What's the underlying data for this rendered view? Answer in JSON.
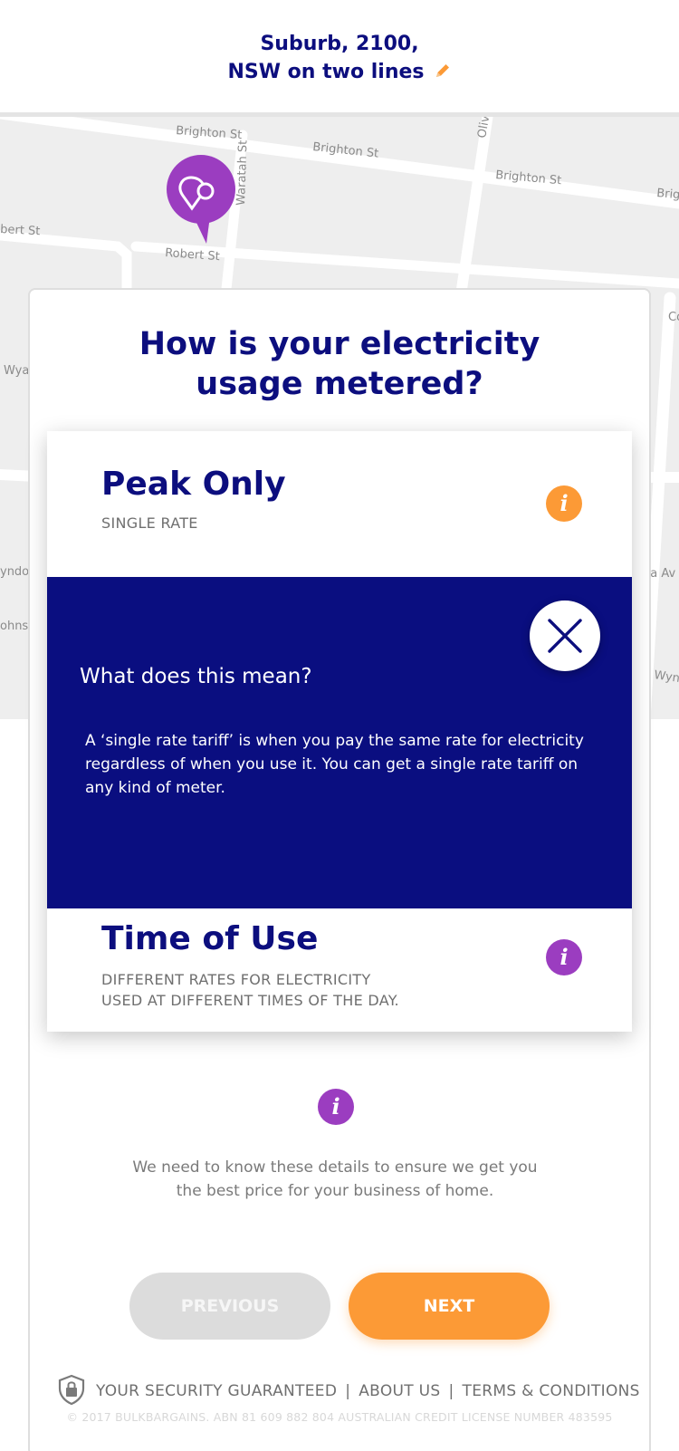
{
  "header": {
    "address_line1": "Suburb, 2100,",
    "address_line2": "NSW on two lines",
    "edit_icon": "pencil-icon",
    "edit_color": "#fc9a36"
  },
  "map": {
    "streets": [
      "Brighton St",
      "Brighton St",
      "Brighton St",
      "Brig",
      "Waratah St",
      "Robert St",
      "Olive",
      "bert St",
      "Wya",
      "Co",
      "yndo",
      "ohnsc",
      "na Av",
      "Wyn"
    ],
    "pin_icon": "location-pin-icon",
    "pin_color": "#9b3dc0"
  },
  "question": {
    "line1": "How is your electricity",
    "line2": "usage metered?"
  },
  "options": [
    {
      "title": "Peak Only",
      "subtitle": "SINGLE RATE",
      "info_icon": "info-icon",
      "info_color": "#fc9a36"
    },
    {
      "title": "Time of Use",
      "subtitle_line1": "DIFFERENT RATES FOR ELECTRICITY",
      "subtitle_line2": "USED AT DIFFERENT TIMES OF THE DAY.",
      "info_icon": "info-icon",
      "info_color": "#9b3dc0"
    }
  ],
  "popup": {
    "title": "What does this mean?",
    "body": "A ‘single rate tariff’ is when you pay the same rate for electricity regardless of when you use it. You can get a single rate tariff on any kind of meter.",
    "close_icon": "close-icon",
    "background": "#0a0e80"
  },
  "help": {
    "info_icon": "info-icon",
    "line1": "We need to know these details to ensure we get you",
    "line2": "the best price for your business of home."
  },
  "buttons": {
    "previous_label": "PREVIOUS",
    "next_label": "NEXT",
    "next_color": "#fc9a36"
  },
  "footer": {
    "shield_icon": "shield-lock-icon",
    "security_label": "YOUR SECURITY GUARANTEED",
    "about_label": "ABOUT US",
    "terms_label": "TERMS & CONDITIONS",
    "separator": "|",
    "copyright": "© 2017 BULKBARGAINS. ABN 81 609 882 804 AUSTRALIAN CREDIT LICENSE NUMBER 483595"
  },
  "colors": {
    "brand_navy": "#0c0e7e",
    "accent_orange": "#fc9a36",
    "accent_purple": "#9b3dc0"
  },
  "info_glyph": "i",
  "info_glyph_2": "i",
  "info_glyph_3": "i"
}
